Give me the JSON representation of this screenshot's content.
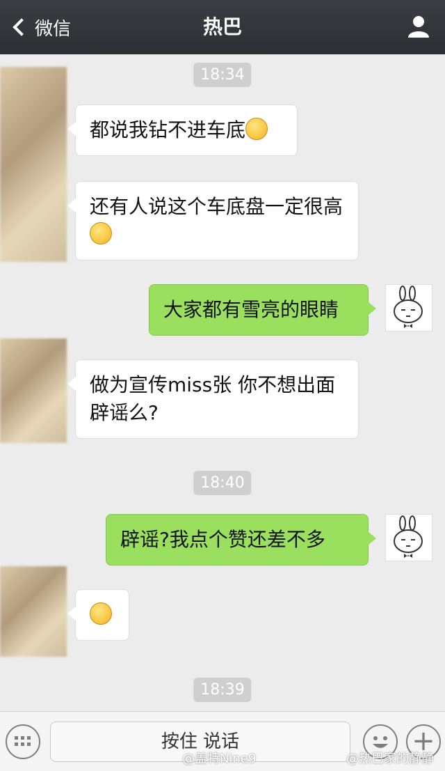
{
  "header": {
    "back_label": "微信",
    "title": "热巴"
  },
  "messages": {
    "t1": "18:34",
    "m1": "都说我钻不进车底",
    "m2": "还有人说这个车底盘一定很高",
    "m3": "大家都有雪亮的眼睛",
    "m4": "做为宣传miss张 你不想出面辟谣么?",
    "t2": "18:40",
    "m5": "辟谣?我点个赞还差不多",
    "t3": "18:39"
  },
  "input": {
    "hold_to_talk": "按住 说话"
  },
  "watermark": {
    "left": "@盖特Nine9",
    "right": "@热巴家的静静"
  }
}
